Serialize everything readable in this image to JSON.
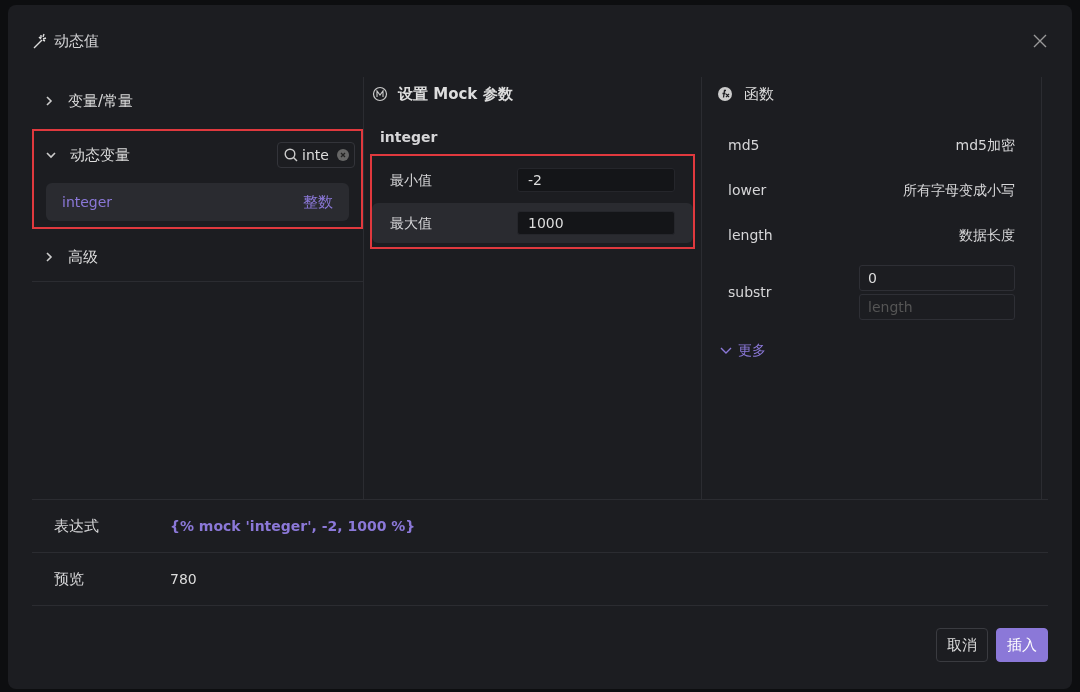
{
  "dialog": {
    "title": "动态值"
  },
  "tree": [
    {
      "label": "变量/常量",
      "expanded": false,
      "highlighted": false
    },
    {
      "label": "动态变量",
      "expanded": true,
      "highlighted": true,
      "search": {
        "value": "inte"
      },
      "items": [
        {
          "name": "integer",
          "desc": "整数",
          "selected": true
        }
      ]
    },
    {
      "label": "高级",
      "expanded": false,
      "highlighted": false
    }
  ],
  "mock": {
    "title": "设置 Mock 参数",
    "subtitle": "integer",
    "highlighted": true,
    "params": [
      {
        "label": "最小值",
        "value": "-2",
        "selected": false
      },
      {
        "label": "最大值",
        "value": "1000",
        "selected": true
      }
    ]
  },
  "functions": {
    "title": "函数",
    "items": [
      {
        "name": "md5",
        "desc": "md5加密",
        "kind": "text"
      },
      {
        "name": "lower",
        "desc": "所有字母变成小写",
        "kind": "text"
      },
      {
        "name": "length",
        "desc": "数据长度",
        "kind": "text"
      },
      {
        "name": "substr",
        "kind": "inputs",
        "inputs": [
          {
            "value": "0"
          },
          {
            "placeholder": "length"
          }
        ]
      }
    ],
    "more": "更多"
  },
  "expression": {
    "label": "表达式",
    "value": "{% mock 'integer', -2, 1000 %}"
  },
  "preview": {
    "label": "预览",
    "value": "780"
  },
  "buttons": [
    {
      "label": "取消",
      "kind": "secondary"
    },
    {
      "label": "插入",
      "kind": "primary"
    }
  ]
}
